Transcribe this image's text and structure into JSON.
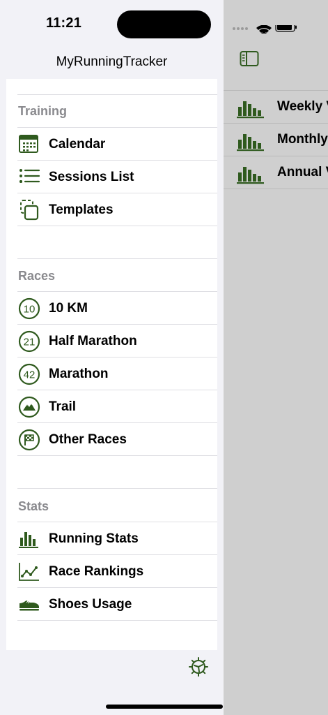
{
  "status_bar": {
    "time": "11:21"
  },
  "app": {
    "title": "MyRunningTracker"
  },
  "sidebar": {
    "sections": [
      {
        "title": "Training",
        "items": [
          {
            "label": "Calendar",
            "icon": "calendar-icon"
          },
          {
            "label": "Sessions List",
            "icon": "list-icon"
          },
          {
            "label": "Templates",
            "icon": "templates-icon"
          }
        ]
      },
      {
        "title": "Races",
        "items": [
          {
            "label": "10 KM",
            "icon": "race-10-icon",
            "badge": "10"
          },
          {
            "label": "Half Marathon",
            "icon": "race-21-icon",
            "badge": "21"
          },
          {
            "label": "Marathon",
            "icon": "race-42-icon",
            "badge": "42"
          },
          {
            "label": "Trail",
            "icon": "mountain-icon"
          },
          {
            "label": "Other Races",
            "icon": "checkered-flag-icon"
          }
        ]
      },
      {
        "title": "Stats",
        "items": [
          {
            "label": "Running Stats",
            "icon": "bar-chart-icon"
          },
          {
            "label": "Race Rankings",
            "icon": "line-chart-icon"
          },
          {
            "label": "Shoes Usage",
            "icon": "shoe-icon"
          }
        ]
      }
    ]
  },
  "detail": {
    "items": [
      {
        "label": "Weekly V"
      },
      {
        "label": "Monthly"
      },
      {
        "label": "Annual V"
      }
    ]
  },
  "colors": {
    "accent": "#2f5a1e",
    "background": "#f2f2f7",
    "card": "#ffffff",
    "section_title": "#8a8a8e",
    "overlay": "#cfcfcf"
  }
}
